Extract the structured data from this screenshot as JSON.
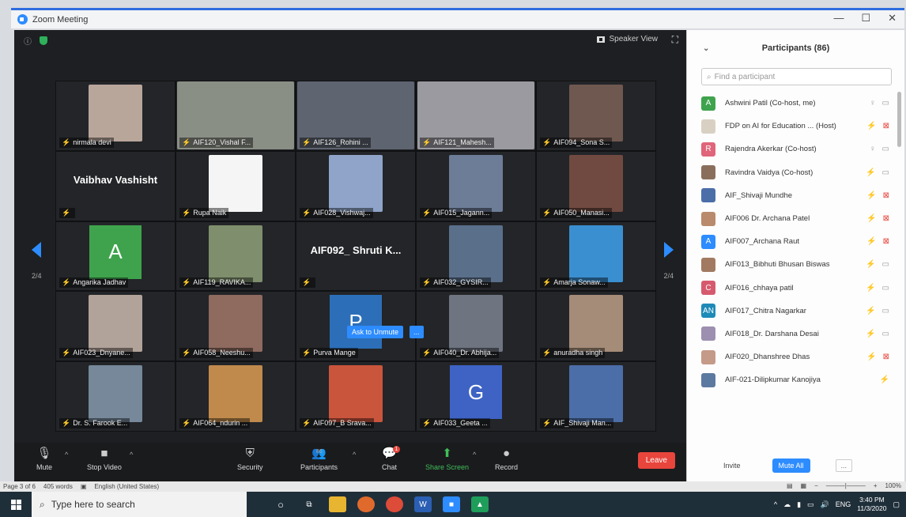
{
  "window": {
    "title": "Zoom Meeting",
    "minimize": "—",
    "maximize": "☐",
    "close": "✕"
  },
  "view": {
    "speaker_view": "Speaker View"
  },
  "pager": {
    "left": "2/4",
    "right": "2/4"
  },
  "ask_unmute": {
    "label": "Ask to Unmute",
    "more": "..."
  },
  "tiles": [
    {
      "name": "nirmala devi",
      "kind": "photo",
      "color": "#b9a69b"
    },
    {
      "name": "AIF120_Vishal F...",
      "kind": "wide",
      "color": "#8a8f85"
    },
    {
      "name": "AIF126_Rohini ...",
      "kind": "wide",
      "color": "#5e6470"
    },
    {
      "name": "AIF121_Mahesh...",
      "kind": "wide",
      "color": "#9a9aa0"
    },
    {
      "name": "AIF094_Sona S...",
      "kind": "photo",
      "color": "#6f5850"
    },
    {
      "name": "",
      "kind": "name",
      "big": "Vaibhav Vashisht"
    },
    {
      "name": "Rupa Naik",
      "kind": "photo",
      "color": "#f5f5f5"
    },
    {
      "name": "AIF028_Vishwaj...",
      "kind": "photo",
      "color": "#8fa4c8"
    },
    {
      "name": "AIF015_Jagann...",
      "kind": "photo",
      "color": "#6d7d98"
    },
    {
      "name": "AIF050_Manasi...",
      "kind": "photo",
      "color": "#704a40"
    },
    {
      "name": "Angarika Jadhav",
      "kind": "letter",
      "letter": "A",
      "color": "#3fa34d"
    },
    {
      "name": "AIF119_RAVIKA...",
      "kind": "photo",
      "color": "#7f8e6c"
    },
    {
      "name": "",
      "kind": "name",
      "big": "AIF092_ Shruti K..."
    },
    {
      "name": "AIF032_GYSIR...",
      "kind": "photo",
      "color": "#5a6f8a"
    },
    {
      "name": "Amarja Sonaw...",
      "kind": "photo",
      "color": "#3a8fd0"
    },
    {
      "name": "AIF023_Dnyane...",
      "kind": "photo",
      "color": "#b2a39a"
    },
    {
      "name": "AIF058_Neeshu...",
      "kind": "photo",
      "color": "#8e6a5f"
    },
    {
      "name": "Purva Mange",
      "kind": "letter",
      "letter": "P",
      "color": "#2c6fb8"
    },
    {
      "name": "AIF040_Dr. Abhija...",
      "kind": "photo",
      "color": "#6e7480"
    },
    {
      "name": "anuradha singh",
      "kind": "photo",
      "color": "#a58c78"
    },
    {
      "name": "Dr. S. Farook E...",
      "kind": "photo",
      "color": "#76889a"
    },
    {
      "name": "AIF064_ndurin ...",
      "kind": "photo",
      "color": "#c08a4c"
    },
    {
      "name": "AIF097_B Srava...",
      "kind": "photo",
      "color": "#c9553c"
    },
    {
      "name": "AIF033_Geeta ...",
      "kind": "letter",
      "letter": "G",
      "color": "#3e63c4"
    },
    {
      "name": "AIF_Shivaji Man...",
      "kind": "photo",
      "color": "#4c6ea8"
    }
  ],
  "toolbar": {
    "mute": "Mute",
    "stop_video": "Stop Video",
    "security": "Security",
    "participants": "Participants",
    "participants_count": "86",
    "chat": "Chat",
    "chat_badge": "1",
    "share_screen": "Share Screen",
    "record": "Record",
    "leave": "Leave"
  },
  "panel": {
    "title": "Participants (86)",
    "search_placeholder": "Find a participant",
    "invite": "Invite",
    "mute_all": "Mute All",
    "more": "...",
    "participants": [
      {
        "name": "Ashwini Patil (Co-host, me)",
        "initials": "A",
        "color": "#3fa34d",
        "mic": "on",
        "cam": "on"
      },
      {
        "name": "FDP on AI for Education ... (Host)",
        "initials": "",
        "color": "#d9d0c4",
        "mic": "off",
        "cam": "off"
      },
      {
        "name": "Rajendra Akerkar (Co-host)",
        "initials": "R",
        "color": "#e0657a",
        "mic": "on",
        "cam": "on"
      },
      {
        "name": "Ravindra Vaidya (Co-host)",
        "initials": "",
        "color": "#8a6e5c",
        "mic": "off",
        "cam": "on"
      },
      {
        "name": "AIF_Shivaji Mundhe",
        "initials": "",
        "color": "#4c6ea8",
        "mic": "off",
        "cam": "off"
      },
      {
        "name": "AIF006 Dr. Archana Patel",
        "initials": "",
        "color": "#b98a6c",
        "mic": "off",
        "cam": "off"
      },
      {
        "name": "AIF007_Archana Raut",
        "initials": "A",
        "color": "#2d8cff",
        "mic": "off",
        "cam": "off"
      },
      {
        "name": "AIF013_Bibhuti Bhusan Biswas",
        "initials": "",
        "color": "#a27a62",
        "mic": "off",
        "cam": "on"
      },
      {
        "name": "AIF016_chhaya patil",
        "initials": "C",
        "color": "#d65a6e",
        "mic": "off",
        "cam": "on"
      },
      {
        "name": "AIF017_Chitra Nagarkar",
        "initials": "AN",
        "color": "#1e8ab8",
        "mic": "off",
        "cam": "on"
      },
      {
        "name": "AIF018_Dr. Darshana Desai",
        "initials": "",
        "color": "#9d8fb0",
        "mic": "off",
        "cam": "on"
      },
      {
        "name": "AIF020_Dhanshree Dhas",
        "initials": "",
        "color": "#c49a88",
        "mic": "off",
        "cam": "off"
      },
      {
        "name": "AIF-021-Dilipkumar Kanojiya",
        "initials": "",
        "color": "#5c7aa0",
        "mic": "off",
        "cam": ""
      }
    ]
  },
  "word_status": {
    "page": "Page 3 of 6",
    "words": "405 words",
    "language": "English (United States)",
    "zoom": "100%"
  },
  "taskbar": {
    "search_placeholder": "Type here to search",
    "time": "3:40 PM",
    "date": "11/3/2020",
    "lang": "ENG"
  }
}
